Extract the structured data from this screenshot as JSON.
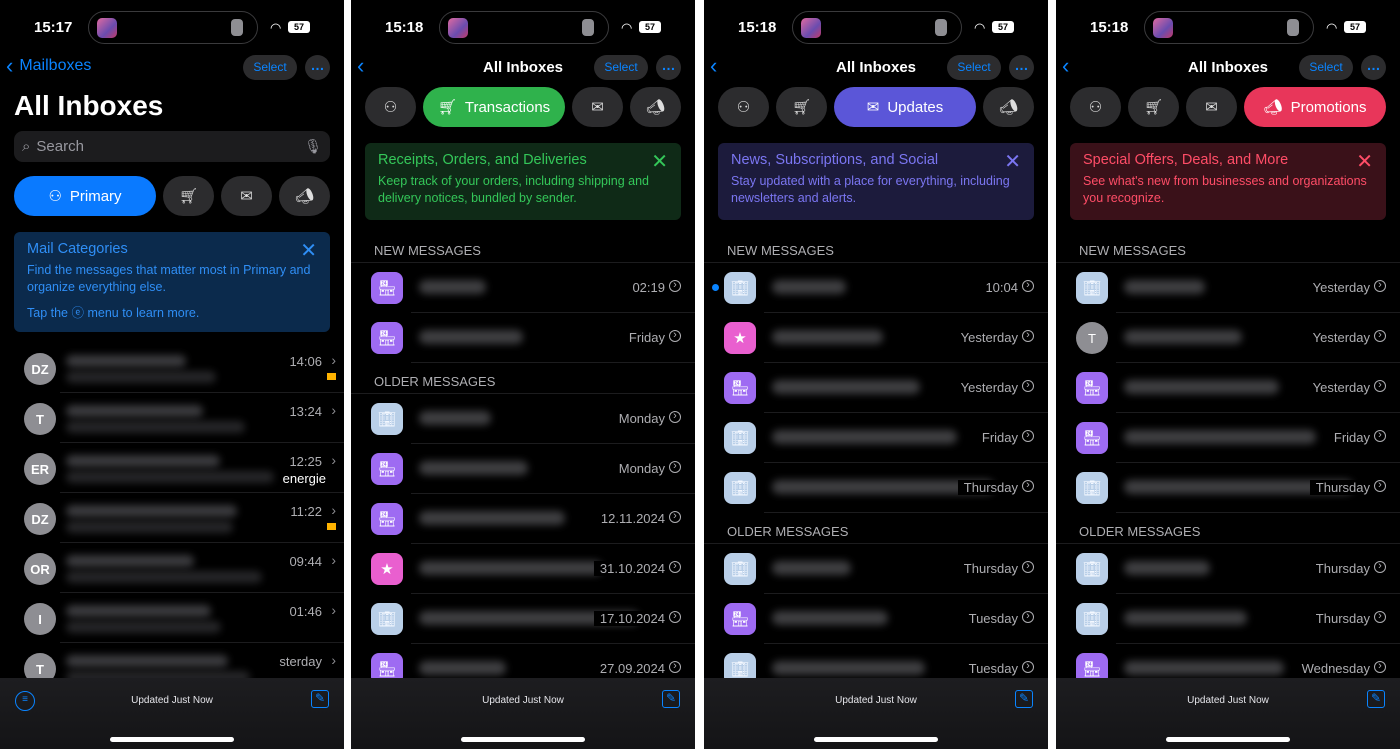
{
  "colors": {
    "accent": "#0a84ff",
    "primary": "#0a7aff",
    "transactions": "#2fb24c",
    "updates": "#5b56d8",
    "promotions": "#e8365a"
  },
  "common": {
    "select_label": "Select",
    "more_icon": "ellipsis-icon",
    "footer_status": "Updated Just Now",
    "battery": "57"
  },
  "panels": [
    {
      "time": "15:17",
      "back_label": "Mailboxes",
      "title": "All Inboxes",
      "search_placeholder": "Search",
      "active_category": 0,
      "categories": [
        {
          "label": "Primary",
          "icon": "person-icon"
        },
        {
          "label": "Transactions",
          "icon": "cart-icon"
        },
        {
          "label": "Updates",
          "icon": "message-icon"
        },
        {
          "label": "Promotions",
          "icon": "megaphone-icon"
        }
      ],
      "banner": {
        "title": "Mail Categories",
        "body": "Find the messages that matter most in Primary and organize everything else.",
        "tap_prefix": "Tap the",
        "tap_suffix": "menu to learn more.",
        "bg": "#0b2a4c",
        "color": "#2f8ef5"
      },
      "messages": [
        {
          "initials": "DZ",
          "time": "14:06",
          "flagged": true
        },
        {
          "initials": "T",
          "time": "13:24",
          "flagged": false
        },
        {
          "initials": "ER",
          "time": "12:25",
          "flagged": false,
          "preview_fragment": "energie"
        },
        {
          "initials": "DZ",
          "time": "11:22",
          "flagged": true
        },
        {
          "initials": "OR",
          "time": "09:44",
          "flagged": false
        },
        {
          "initials": "I",
          "time": "01:46",
          "flagged": false
        },
        {
          "initials": "T",
          "time": "sterday",
          "flagged": false
        }
      ]
    },
    {
      "time": "15:18",
      "title": "All Inboxes",
      "active_category": 1,
      "categories": [
        {
          "label": "Primary",
          "icon": "person-icon"
        },
        {
          "label": "Transactions",
          "icon": "cart-icon"
        },
        {
          "label": "Updates",
          "icon": "message-icon"
        },
        {
          "label": "Promotions",
          "icon": "megaphone-icon"
        }
      ],
      "banner": {
        "title": "Receipts, Orders, and Deliveries",
        "body": "Keep track of your orders, including shipping and delivery notices, bundled by sender.",
        "bg": "#0f2a17",
        "color": "#34c759"
      },
      "sections": [
        {
          "label": "NEW MESSAGES",
          "rows": [
            {
              "icon": "store",
              "time": "02:19"
            },
            {
              "icon": "store",
              "time": "Friday"
            }
          ]
        },
        {
          "label": "OLDER MESSAGES",
          "rows": [
            {
              "icon": "building",
              "time": "Monday"
            },
            {
              "icon": "store",
              "time": "Monday"
            },
            {
              "icon": "store",
              "time": "12.11.2024"
            },
            {
              "icon": "star",
              "time": "31.10.2024"
            },
            {
              "icon": "building",
              "time": "17.10.2024"
            },
            {
              "icon": "store",
              "time": "27.09.2024"
            }
          ]
        }
      ]
    },
    {
      "time": "15:18",
      "title": "All Inboxes",
      "active_category": 2,
      "categories": [
        {
          "label": "Primary",
          "icon": "person-icon"
        },
        {
          "label": "Transactions",
          "icon": "cart-icon"
        },
        {
          "label": "Updates",
          "icon": "message-icon"
        },
        {
          "label": "Promotions",
          "icon": "megaphone-icon"
        }
      ],
      "banner": {
        "title": "News, Subscriptions, and Social",
        "body": "Stay updated with a place for everything, including newsletters and alerts.",
        "bg": "#1c1b3c",
        "color": "#7b76f2"
      },
      "sections": [
        {
          "label": "NEW MESSAGES",
          "rows": [
            {
              "icon": "building",
              "time": "10:04",
              "unread": true
            },
            {
              "icon": "star",
              "time": "Yesterday"
            },
            {
              "icon": "store",
              "time": "Yesterday"
            },
            {
              "icon": "building",
              "time": "Friday"
            },
            {
              "icon": "building",
              "time": "Thursday"
            }
          ]
        },
        {
          "label": "OLDER MESSAGES",
          "rows": [
            {
              "icon": "building",
              "time": "Thursday"
            },
            {
              "icon": "store",
              "time": "Tuesday"
            },
            {
              "icon": "building",
              "time": "Tuesday"
            }
          ]
        }
      ]
    },
    {
      "time": "15:18",
      "title": "All Inboxes",
      "active_category": 3,
      "categories": [
        {
          "label": "Primary",
          "icon": "person-icon"
        },
        {
          "label": "Transactions",
          "icon": "cart-icon"
        },
        {
          "label": "Updates",
          "icon": "message-icon"
        },
        {
          "label": "Promotions",
          "icon": "megaphone-icon"
        }
      ],
      "banner": {
        "title": "Special Offers, Deals, and More",
        "body": "See what's new from businesses and organizations you recognize.",
        "bg": "#3a1119",
        "color": "#ff4d67"
      },
      "sections": [
        {
          "label": "NEW MESSAGES",
          "rows": [
            {
              "icon": "building",
              "time": "Yesterday"
            },
            {
              "icon": "initial",
              "initial": "T",
              "time": "Yesterday"
            },
            {
              "icon": "store",
              "time": "Yesterday"
            },
            {
              "icon": "store",
              "time": "Friday"
            },
            {
              "icon": "building",
              "time": "Thursday"
            }
          ]
        },
        {
          "label": "OLDER MESSAGES",
          "rows": [
            {
              "icon": "building",
              "time": "Thursday"
            },
            {
              "icon": "building",
              "time": "Thursday"
            },
            {
              "icon": "store",
              "time": "Wednesday"
            }
          ]
        }
      ]
    }
  ]
}
